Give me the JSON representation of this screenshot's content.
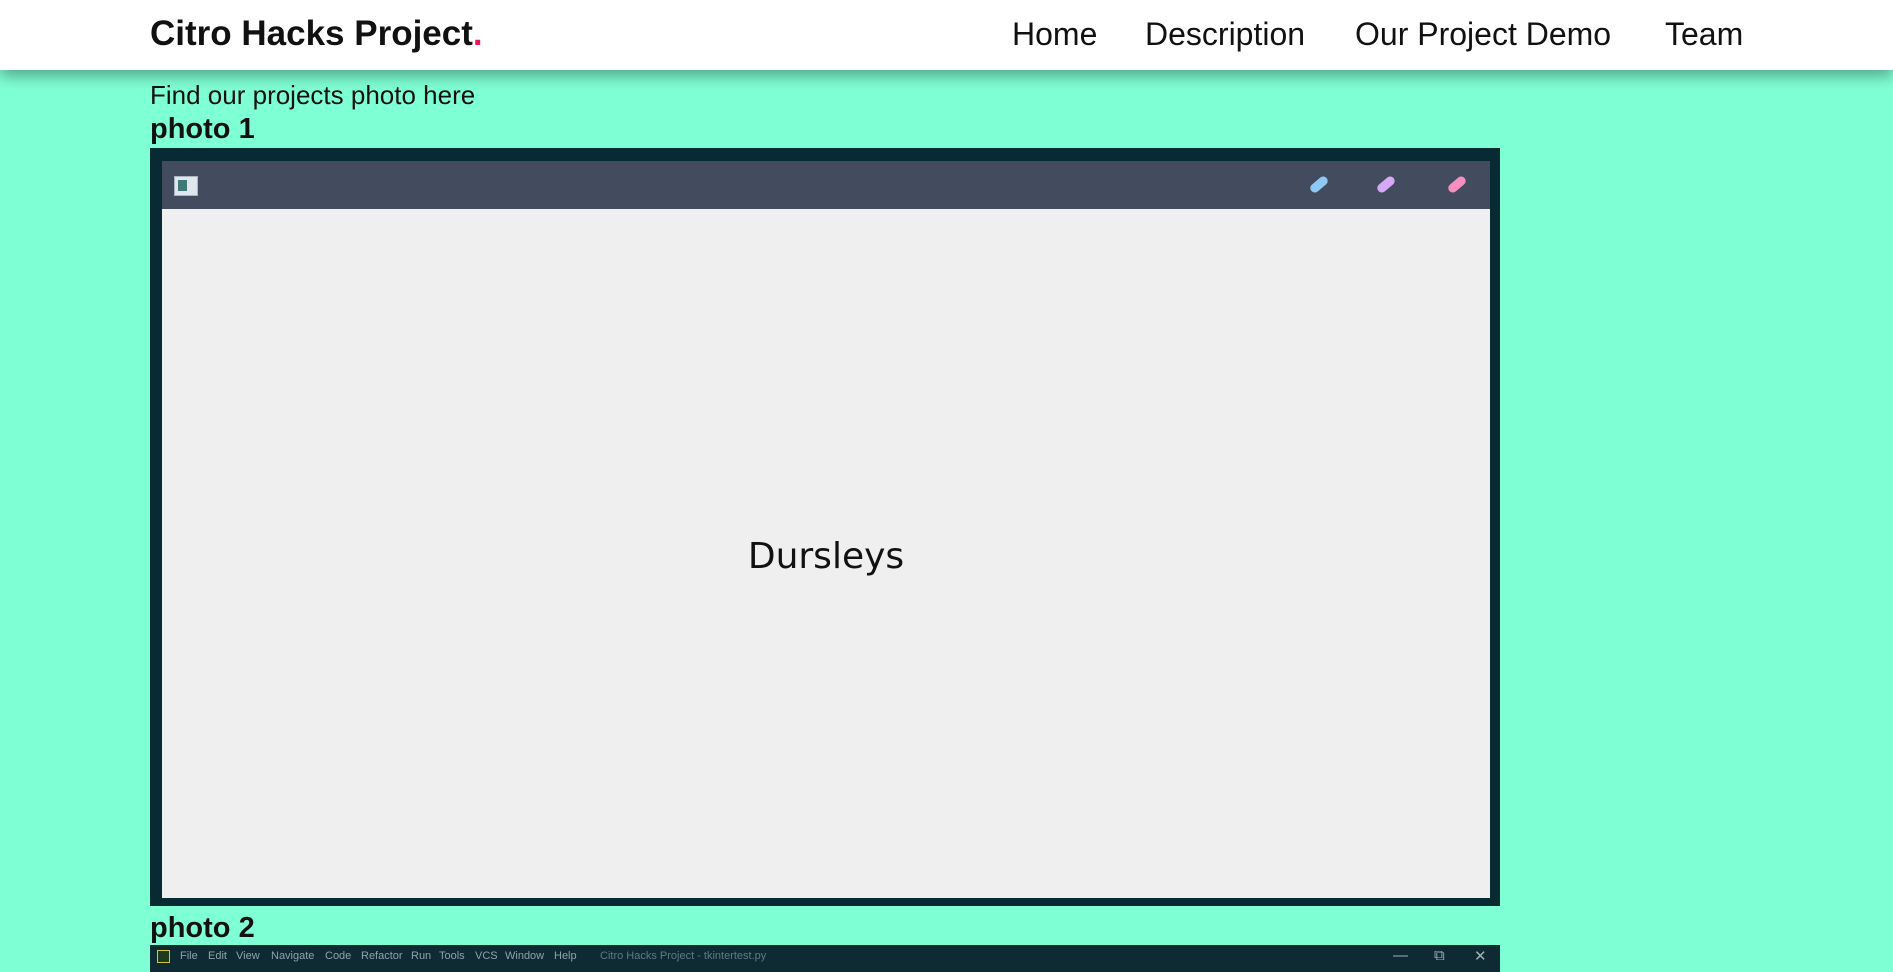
{
  "navbar": {
    "brand": "Citro Hacks Project",
    "brand_dot": ".",
    "brand_dot_color": "#e8175d",
    "links": [
      "Home",
      "Description",
      "Our Project Demo",
      "Team"
    ]
  },
  "intro": "Find our projects photo here",
  "photo1": {
    "heading": "photo 1",
    "app_label": "Dursleys",
    "pen_colors": [
      "#8ec9f5",
      "#d7a8f5",
      "#f58fc0"
    ]
  },
  "photo2": {
    "heading": "photo 2",
    "menu": [
      "File",
      "Edit",
      "View",
      "Navigate",
      "Code",
      "Refactor",
      "Run",
      "Tools",
      "VCS",
      "Window",
      "Help"
    ],
    "window_title": "Citro Hacks Project - tkintertest.py",
    "window_buttons": [
      "—",
      "⧉",
      "✕"
    ]
  },
  "colors": {
    "page_background": "#7fffd4",
    "navbar_background": "#ffffff",
    "app_titlebar": "#434c5e",
    "app_body": "#efefef"
  }
}
